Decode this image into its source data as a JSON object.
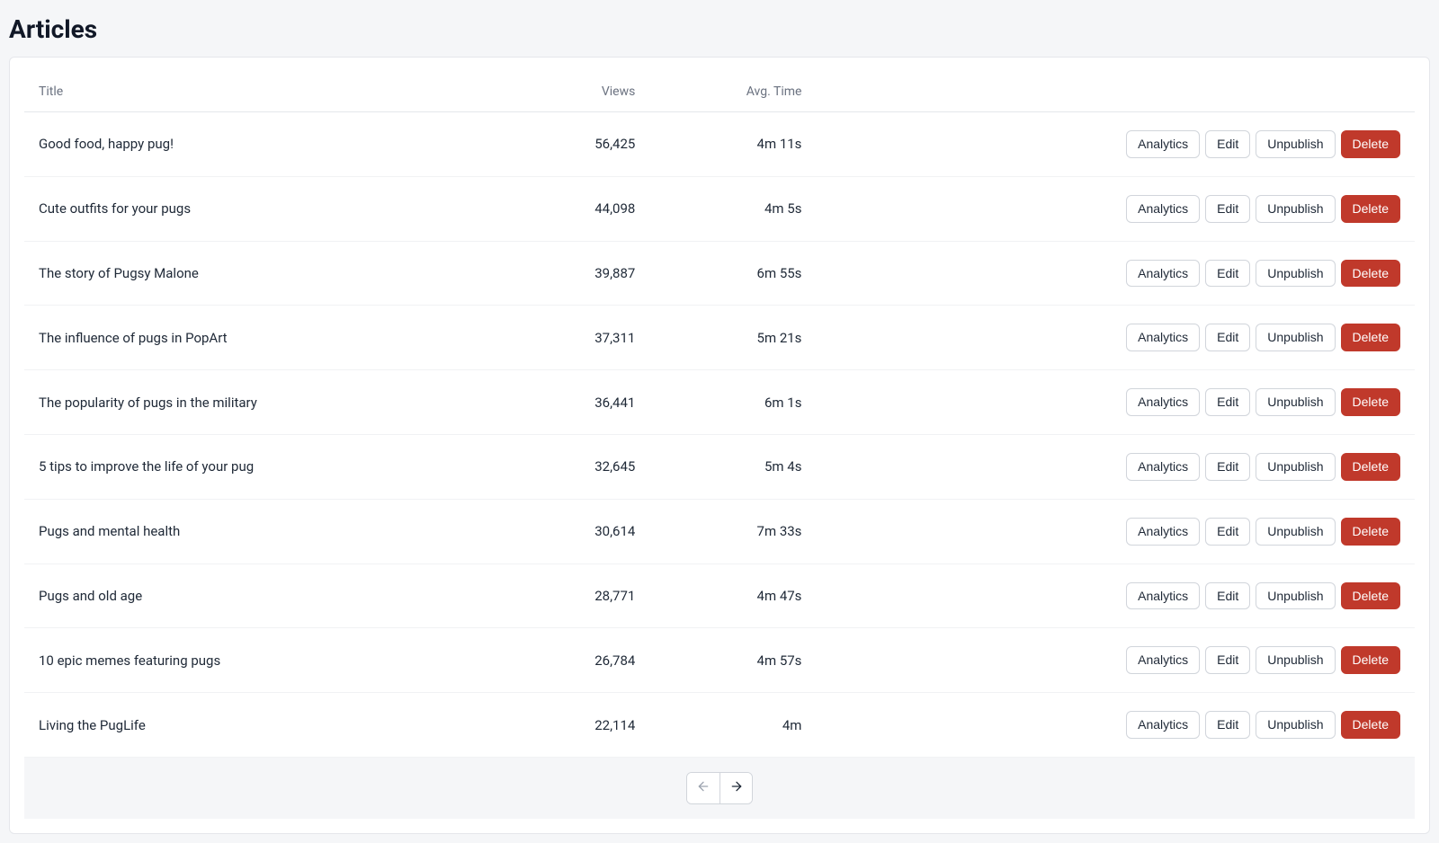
{
  "page": {
    "title": "Articles"
  },
  "table": {
    "columns": {
      "title": "Title",
      "views": "Views",
      "avg_time": "Avg. Time"
    },
    "actions": {
      "analytics": "Analytics",
      "edit": "Edit",
      "unpublish": "Unpublish",
      "delete": "Delete"
    },
    "rows": [
      {
        "title": "Good food, happy pug!",
        "views": "56,425",
        "avg_time": "4m 11s"
      },
      {
        "title": "Cute outfits for your pugs",
        "views": "44,098",
        "avg_time": "4m 5s"
      },
      {
        "title": "The story of Pugsy Malone",
        "views": "39,887",
        "avg_time": "6m 55s"
      },
      {
        "title": "The influence of pugs in PopArt",
        "views": "37,311",
        "avg_time": "5m 21s"
      },
      {
        "title": "The popularity of pugs in the military",
        "views": "36,441",
        "avg_time": "6m 1s"
      },
      {
        "title": "5 tips to improve the life of your pug",
        "views": "32,645",
        "avg_time": "5m 4s"
      },
      {
        "title": "Pugs and mental health",
        "views": "30,614",
        "avg_time": "7m 33s"
      },
      {
        "title": "Pugs and old age",
        "views": "28,771",
        "avg_time": "4m 47s"
      },
      {
        "title": "10 epic memes featuring pugs",
        "views": "26,784",
        "avg_time": "4m 57s"
      },
      {
        "title": "Living the PugLife",
        "views": "22,114",
        "avg_time": "4m"
      }
    ]
  },
  "pagination": {
    "prev_enabled": false,
    "next_enabled": true
  }
}
